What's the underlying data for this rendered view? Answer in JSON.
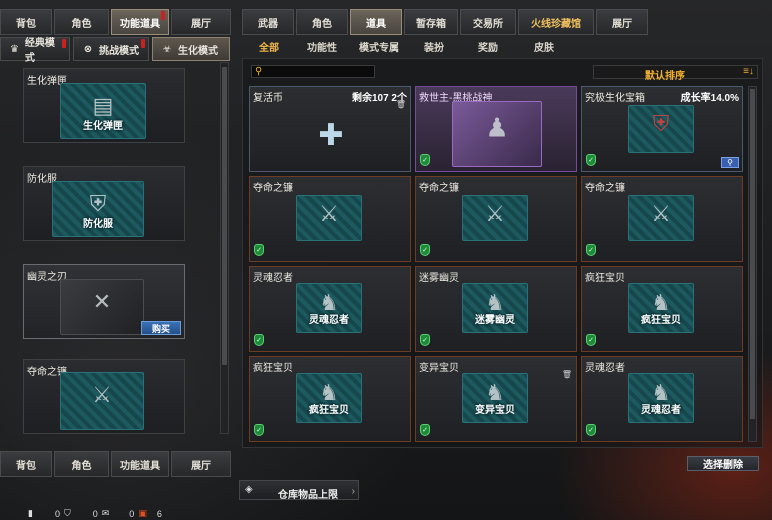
{
  "left_tabs": [
    {
      "label": "背包"
    },
    {
      "label": "角色"
    },
    {
      "label": "功能道具"
    },
    {
      "label": "展厅"
    }
  ],
  "mode_tabs": [
    {
      "label": "经典模式",
      "icon": "crown-icon"
    },
    {
      "label": "挑战模式",
      "icon": "swords-icon"
    },
    {
      "label": "生化模式",
      "icon": "biohazard-icon"
    }
  ],
  "left_items": [
    {
      "title": "生化弹匣",
      "art_label": "生化弹匣"
    },
    {
      "title": "防化服",
      "art_label": "防化服"
    },
    {
      "title": "幽灵之刃",
      "art_label": "",
      "buy_label": "购买"
    },
    {
      "title": "夺命之镰",
      "art_label": ""
    }
  ],
  "right_tabs": [
    {
      "label": "武器"
    },
    {
      "label": "角色"
    },
    {
      "label": "道具"
    },
    {
      "label": "暂存箱"
    },
    {
      "label": "交易所"
    },
    {
      "label": "火线珍藏馆"
    },
    {
      "label": "展厅"
    }
  ],
  "sub_tabs": [
    {
      "label": "全部"
    },
    {
      "label": "功能性"
    },
    {
      "label": "模式专属"
    },
    {
      "label": "装扮"
    },
    {
      "label": "奖励"
    },
    {
      "label": "皮肤"
    }
  ],
  "sort": {
    "label": "默认排序",
    "search_placeholder": ""
  },
  "grid": [
    {
      "title": "复活币",
      "right": "剩余107 2个",
      "art": "",
      "trash": "🗑"
    },
    {
      "title": "救世主-黑桃战神",
      "right": "",
      "art": ""
    },
    {
      "title": "究极生化宝箱",
      "right": "成长率14.0%",
      "art": ""
    },
    {
      "title": "夺命之镰",
      "right": "",
      "art": ""
    },
    {
      "title": "夺命之镰",
      "right": "",
      "art": ""
    },
    {
      "title": "夺命之镰",
      "right": "",
      "art": ""
    },
    {
      "title": "灵魂忍者",
      "right": "",
      "art": "灵魂忍者"
    },
    {
      "title": "迷雾幽灵",
      "right": "",
      "art": "迷雾幽灵"
    },
    {
      "title": "疯狂宝贝",
      "right": "",
      "art": "疯狂宝贝"
    },
    {
      "title": "疯狂宝贝",
      "right": "",
      "art": "疯狂宝贝"
    },
    {
      "title": "变异宝贝",
      "right": "",
      "art": "变异宝贝",
      "trash": "🗑"
    },
    {
      "title": "灵魂忍者",
      "right": "",
      "art": "灵魂忍者"
    }
  ],
  "select_delete_label": "选择删除",
  "storage_label": "仓库物品上限",
  "status": {
    "a": "0",
    "b": "0",
    "c": "0",
    "d": "6"
  }
}
